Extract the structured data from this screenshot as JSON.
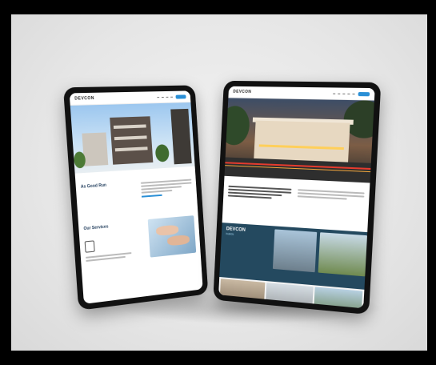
{
  "scene": {
    "colors": {
      "background": "#e9e9e9",
      "frame": "#000000",
      "accent": "#2a8fd6",
      "dark_band": "#24495f"
    }
  },
  "tablet_left": {
    "logo": "DEVCON",
    "nav_links": [
      "",
      "",
      "",
      "",
      ""
    ],
    "section_heading_1": "As Good Run",
    "section_heading_2": "Our Services"
  },
  "tablet_right": {
    "logo": "DEVCON",
    "nav_links": [
      "",
      "",
      "",
      "",
      ""
    ],
    "band_title": "DEVCON",
    "band_subtitle": "builds"
  }
}
